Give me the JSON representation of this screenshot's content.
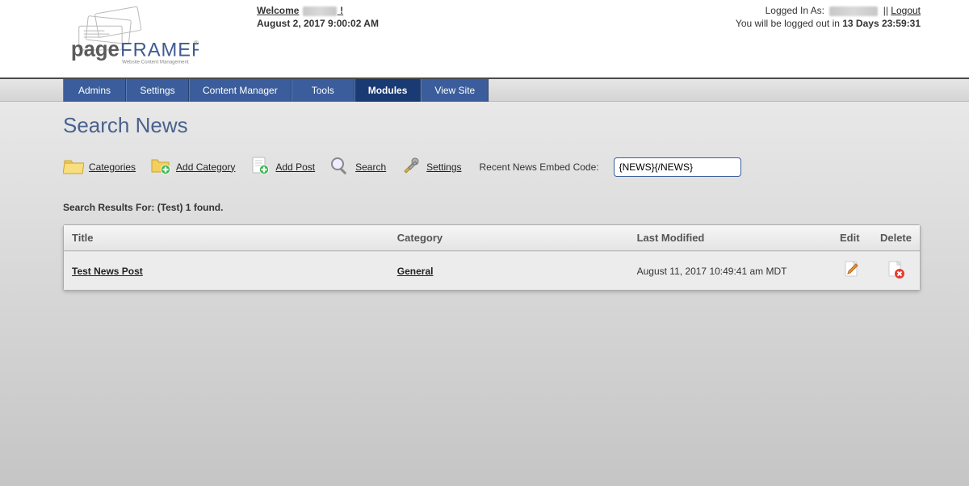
{
  "header": {
    "welcome_label": "Welcome",
    "welcome_bang": " !",
    "date": "August 2, 2017 9:00:02 AM",
    "logged_in_prefix": "Logged In As:",
    "separator": " || ",
    "logout": "Logout",
    "session_msg_prefix": "You will be logged out in ",
    "session_time": "13 Days 23:59:31"
  },
  "logo": {
    "word1": "page",
    "word2": "FRAMER",
    "tagline": "Website Content Management"
  },
  "nav": {
    "tabs": [
      {
        "label": "Admins",
        "active": false
      },
      {
        "label": "Settings",
        "active": false
      },
      {
        "label": "Content Manager",
        "active": false
      },
      {
        "label": "Tools",
        "active": false
      },
      {
        "label": "Modules",
        "active": true
      },
      {
        "label": "View Site",
        "active": false
      }
    ]
  },
  "page": {
    "title": "Search News",
    "toolbar": {
      "categories": "Categories",
      "add_category": "Add Category",
      "add_post": "Add Post",
      "search": "Search",
      "settings": "Settings",
      "embed_label": "Recent News Embed Code:",
      "embed_value": "{NEWS}{/NEWS}"
    },
    "results_label": "Search Results For: (Test) 1 found.",
    "table": {
      "columns": {
        "title": "Title",
        "category": "Category",
        "last_modified": "Last Modified",
        "edit": "Edit",
        "delete": "Delete"
      },
      "rows": [
        {
          "title": "Test News Post",
          "category": "General",
          "last_modified": "August 11, 2017 10:49:41 am MDT"
        }
      ]
    }
  }
}
